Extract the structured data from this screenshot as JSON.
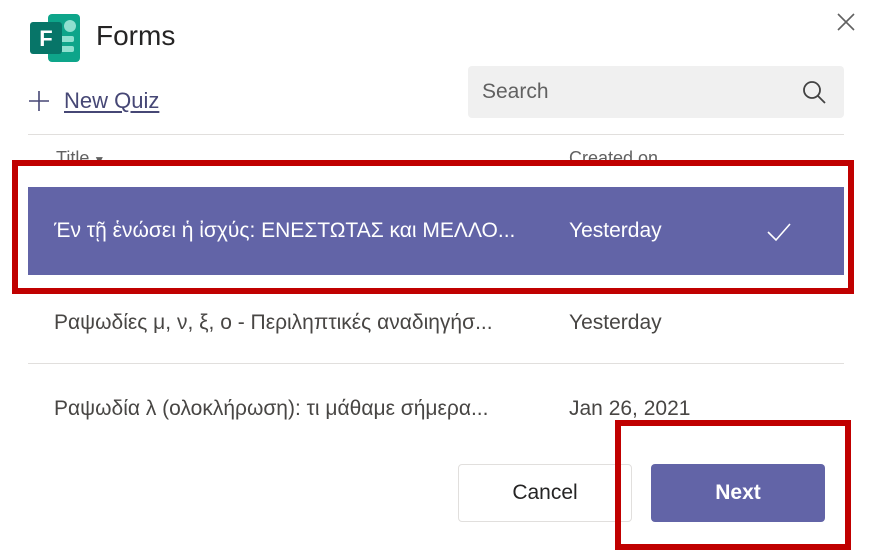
{
  "header": {
    "app_title": "Forms",
    "logo_icon": "forms-logo-icon",
    "close_icon": "close-icon"
  },
  "toolbar": {
    "new_quiz_label": "New Quiz",
    "search_placeholder": "Search"
  },
  "table": {
    "columns": [
      "Title",
      "Created on"
    ],
    "rows": [
      {
        "title": "Έν τῇ ἑνώσει ἡ ἰσχύς: ΕΝΕΣΤΩΤΑΣ και ΜΕΛΛΟ...",
        "created": "Yesterday",
        "selected": true
      },
      {
        "title": "Ραψωδίες μ, ν, ξ, ο - Περιληπτικές αναδιηγήσ...",
        "created": "Yesterday",
        "selected": false
      },
      {
        "title": "Ραψωδία λ (ολοκλήρωση): τι μάθαμε σήμερα...",
        "created": "Jan 26, 2021",
        "selected": false
      }
    ]
  },
  "footer": {
    "cancel_label": "Cancel",
    "next_label": "Next"
  },
  "colors": {
    "accent": "#6264a7",
    "highlight": "#c00000",
    "logo_green": "#077568"
  }
}
